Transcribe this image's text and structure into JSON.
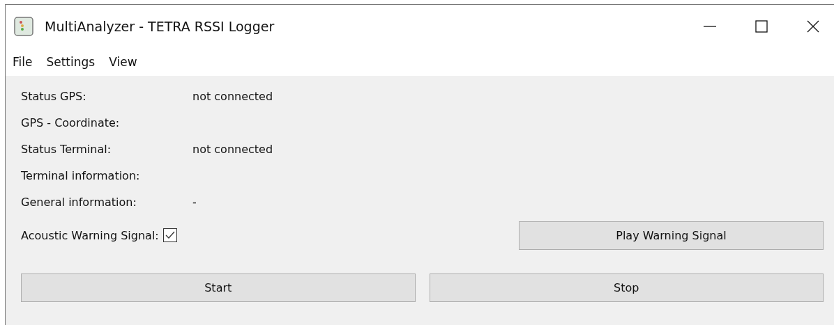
{
  "window": {
    "title": "MultiAnalyzer - TETRA RSSI Logger"
  },
  "menu": [
    "File",
    "Settings",
    "View"
  ],
  "fields": [
    {
      "label": "Status GPS:",
      "value": "not connected"
    },
    {
      "label": "GPS - Coordinate:"
    },
    {
      "label": "Status Terminal:",
      "value": "not connected"
    },
    {
      "label": "Terminal information:"
    },
    {
      "label": "General information:",
      "value": "-"
    }
  ],
  "acoustic_warning": {
    "label": "Acoustic Warning Signal:",
    "checked": true
  },
  "play_button": "Play Warning Signal",
  "buttons": [
    "Start",
    "Stop"
  ]
}
